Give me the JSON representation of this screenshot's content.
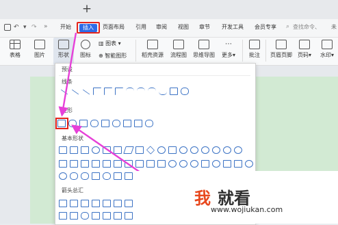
{
  "menu": {
    "items": [
      "开始",
      "插入",
      "页面布局",
      "引用",
      "审阅",
      "视图",
      "章节",
      "开发工具",
      "会员专享"
    ],
    "search_placeholder": "查找命令、",
    "right_text": "未"
  },
  "ribbon": {
    "table": "表格",
    "image": "图片",
    "shape": "形状",
    "icon": "图标",
    "chart": "图表",
    "smart_graphic": "智能图形",
    "dock_resource": "稻壳资源",
    "flowchart": "流程图",
    "mindmap": "思维导图",
    "more": "更多",
    "comment": "批注",
    "header_footer": "页眉页脚",
    "page_number": "页码",
    "watermark": "水印"
  },
  "dropdown": {
    "preset": "预设",
    "lines": "线条",
    "rectangles": "矩形",
    "basic_shapes": "基本形状",
    "arrows_summary": "箭头总汇"
  },
  "watermark": {
    "logo_red": "我",
    "logo_dark": "就看",
    "url": "www.wojiukan.com"
  },
  "colors": {
    "accent_blue": "#2e6be6",
    "highlight_red": "#e5241b",
    "arrow_magenta": "#e640d8",
    "page_green": "#d2ead3"
  }
}
